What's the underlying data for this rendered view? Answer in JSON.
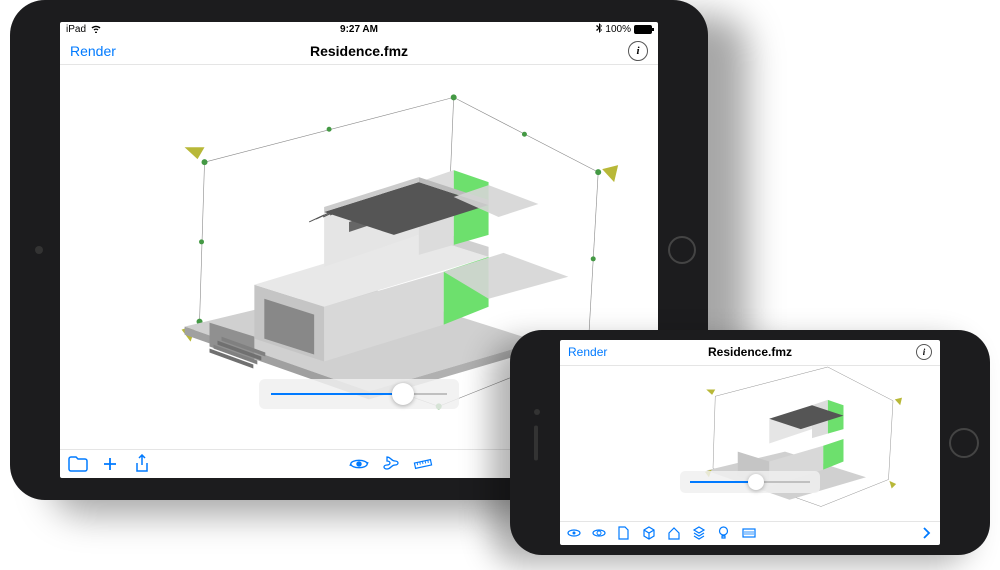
{
  "statusBar": {
    "deviceLabel": "iPad",
    "time": "9:27 AM",
    "batteryPercent": "100%"
  },
  "navBar": {
    "backLabel": "Render",
    "title": "Residence.fmz"
  },
  "slider": {
    "value": 75
  },
  "toolbar": {
    "folderLabel": "folder",
    "addLabel": "add",
    "shareLabel": "share",
    "orbitLabel": "orbit",
    "sectionLabel": "section",
    "measureLabel": "measure",
    "visibilityLabel": "visibility"
  },
  "iphone": {
    "navBar": {
      "backLabel": "Render",
      "title": "Residence.fmz"
    },
    "toolbar": {
      "tools": [
        "view1",
        "view2",
        "page",
        "cube",
        "home",
        "layers",
        "bulb",
        "effects"
      ]
    }
  },
  "colors": {
    "accent": "#007aff",
    "clipPlane": "#6de06d"
  }
}
